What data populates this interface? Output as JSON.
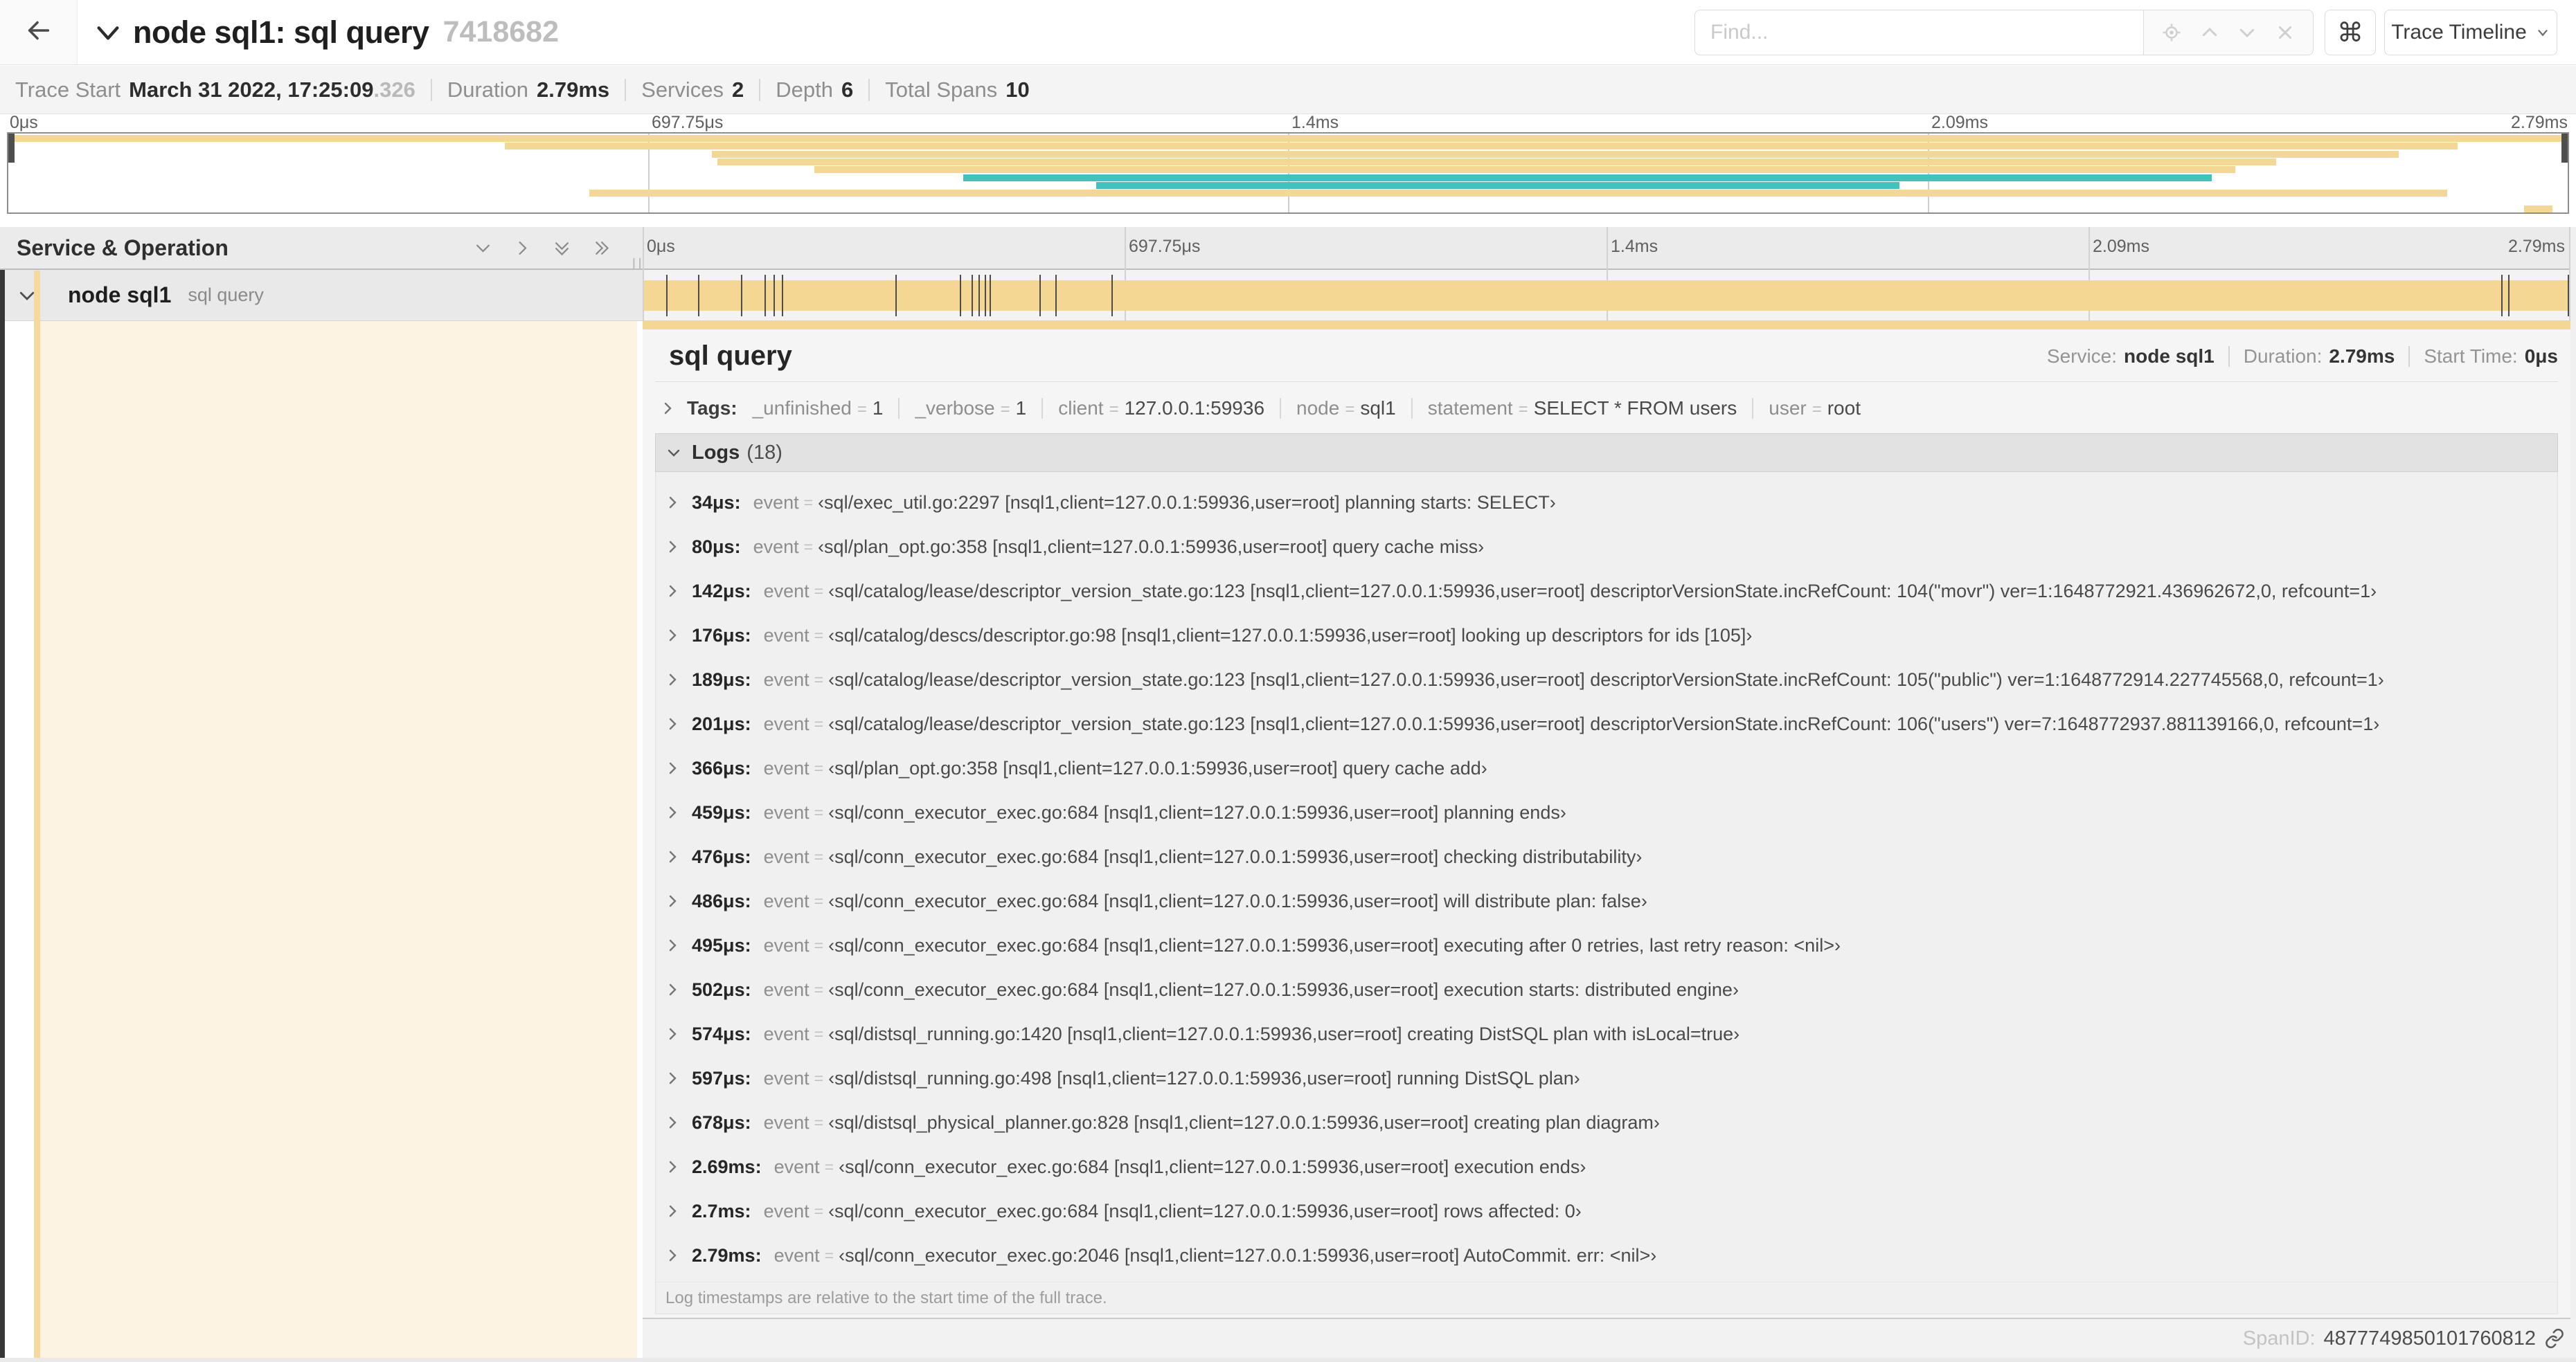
{
  "colors": {
    "tan": "#F5D794",
    "tan_stripe": "#F5D99E",
    "cream": "#FCF3E2",
    "teal": "#41C3BD"
  },
  "topnav": {
    "title": "node sql1: sql query",
    "trace_id": "7418682",
    "find_placeholder": "Find...",
    "keyboard_shortcut_glyph": "⌘",
    "view_selector_label": "Trace Timeline",
    "find_addon_icons": [
      "locate-icon",
      "chevron-up-icon",
      "chevron-down-icon",
      "close-icon"
    ]
  },
  "trace_info": {
    "items": [
      {
        "label": "Trace Start",
        "value": "March 31 2022, 17:25:09",
        "suffix": ".326"
      },
      {
        "label": "Duration",
        "value": "2.79ms"
      },
      {
        "label": "Services",
        "value": "2"
      },
      {
        "label": "Depth",
        "value": "6"
      },
      {
        "label": "Total Spans",
        "value": "10"
      }
    ]
  },
  "minimap": {
    "ticks": [
      "0μs",
      "697.75μs",
      "1.4ms",
      "2.09ms",
      "2.79ms"
    ],
    "spans": [
      {
        "row": 0,
        "start": 0,
        "end": 100,
        "color": "tan"
      },
      {
        "row": 1,
        "start": 19.4,
        "end": 95.7,
        "color": "tan"
      },
      {
        "row": 2,
        "start": 27.5,
        "end": 93.4,
        "color": "tan"
      },
      {
        "row": 3,
        "start": 27.7,
        "end": 88.6,
        "color": "tan"
      },
      {
        "row": 4,
        "start": 31.5,
        "end": 87.0,
        "color": "tan"
      },
      {
        "row": 5,
        "start": 37.3,
        "end": 86.1,
        "color": "teal"
      },
      {
        "row": 6,
        "start": 42.5,
        "end": 73.9,
        "color": "teal"
      },
      {
        "row": 7,
        "start": 22.7,
        "end": 95.3,
        "color": "tan"
      },
      {
        "row": 9,
        "start": 98.3,
        "end": 99.4,
        "color": "tan"
      }
    ]
  },
  "timeline": {
    "left_header": "Service & Operation",
    "ticks": [
      "0μs",
      "697.75μs",
      "1.4ms",
      "2.09ms",
      "2.79ms"
    ],
    "total_duration": "2.79ms",
    "row": {
      "service": "node sql1",
      "operation": "sql query"
    }
  },
  "detail": {
    "operation": "sql query",
    "meta": [
      {
        "label": "Service:",
        "value": "node sql1"
      },
      {
        "label": "Duration:",
        "value": "2.79ms"
      },
      {
        "label": "Start Time:",
        "value": "0μs"
      }
    ],
    "tags_label": "Tags:",
    "tags": [
      {
        "key": "_unfinished",
        "value": "1"
      },
      {
        "key": "_verbose",
        "value": "1"
      },
      {
        "key": "client",
        "value": "127.0.0.1:59936"
      },
      {
        "key": "node",
        "value": "sql1"
      },
      {
        "key": "statement",
        "value": "SELECT * FROM users"
      },
      {
        "key": "user",
        "value": "root"
      }
    ],
    "logs_label": "Logs",
    "logs_count": "(18)",
    "logs": [
      {
        "t": "34μs",
        "key": "event",
        "value": "sql/exec_util.go:2297 [nsql1,client=127.0.0.1:59936,user=root] planning starts: SELECT"
      },
      {
        "t": "80μs",
        "key": "event",
        "value": "sql/plan_opt.go:358 [nsql1,client=127.0.0.1:59936,user=root] query cache miss"
      },
      {
        "t": "142μs",
        "key": "event",
        "value": "sql/catalog/lease/descriptor_version_state.go:123 [nsql1,client=127.0.0.1:59936,user=root] descriptorVersionState.incRefCount: 104(\"movr\") ver=1:1648772921.436962672,0, refcount=1"
      },
      {
        "t": "176μs",
        "key": "event",
        "value": "sql/catalog/descs/descriptor.go:98 [nsql1,client=127.0.0.1:59936,user=root] looking up descriptors for ids [105]"
      },
      {
        "t": "189μs",
        "key": "event",
        "value": "sql/catalog/lease/descriptor_version_state.go:123 [nsql1,client=127.0.0.1:59936,user=root] descriptorVersionState.incRefCount: 105(\"public\") ver=1:1648772914.227745568,0, refcount=1"
      },
      {
        "t": "201μs",
        "key": "event",
        "value": "sql/catalog/lease/descriptor_version_state.go:123 [nsql1,client=127.0.0.1:59936,user=root] descriptorVersionState.incRefCount: 106(\"users\") ver=7:1648772937.881139166,0, refcount=1"
      },
      {
        "t": "366μs",
        "key": "event",
        "value": "sql/plan_opt.go:358 [nsql1,client=127.0.0.1:59936,user=root] query cache add"
      },
      {
        "t": "459μs",
        "key": "event",
        "value": "sql/conn_executor_exec.go:684 [nsql1,client=127.0.0.1:59936,user=root] planning ends"
      },
      {
        "t": "476μs",
        "key": "event",
        "value": "sql/conn_executor_exec.go:684 [nsql1,client=127.0.0.1:59936,user=root] checking distributability"
      },
      {
        "t": "486μs",
        "key": "event",
        "value": "sql/conn_executor_exec.go:684 [nsql1,client=127.0.0.1:59936,user=root] will distribute plan: false"
      },
      {
        "t": "495μs",
        "key": "event",
        "value": "sql/conn_executor_exec.go:684 [nsql1,client=127.0.0.1:59936,user=root] executing after 0 retries, last retry reason: <nil>"
      },
      {
        "t": "502μs",
        "key": "event",
        "value": "sql/conn_executor_exec.go:684 [nsql1,client=127.0.0.1:59936,user=root] execution starts: distributed engine"
      },
      {
        "t": "574μs",
        "key": "event",
        "value": "sql/distsql_running.go:1420 [nsql1,client=127.0.0.1:59936,user=root] creating DistSQL plan with isLocal=true"
      },
      {
        "t": "597μs",
        "key": "event",
        "value": "sql/distsql_running.go:498 [nsql1,client=127.0.0.1:59936,user=root] running DistSQL plan"
      },
      {
        "t": "678μs",
        "key": "event",
        "value": "sql/distsql_physical_planner.go:828 [nsql1,client=127.0.0.1:59936,user=root] creating plan diagram"
      },
      {
        "t": "2.69ms",
        "key": "event",
        "value": "sql/conn_executor_exec.go:684 [nsql1,client=127.0.0.1:59936,user=root] execution ends"
      },
      {
        "t": "2.7ms",
        "key": "event",
        "value": "sql/conn_executor_exec.go:684 [nsql1,client=127.0.0.1:59936,user=root] rows affected: 0"
      },
      {
        "t": "2.79ms",
        "key": "event",
        "value": "sql/conn_executor_exec.go:2046 [nsql1,client=127.0.0.1:59936,user=root] AutoCommit. err: <nil>"
      }
    ],
    "logs_note": "Log timestamps are relative to the start time of the full trace.",
    "span_id_label": "SpanID:",
    "span_id": "4877749850101760812"
  }
}
